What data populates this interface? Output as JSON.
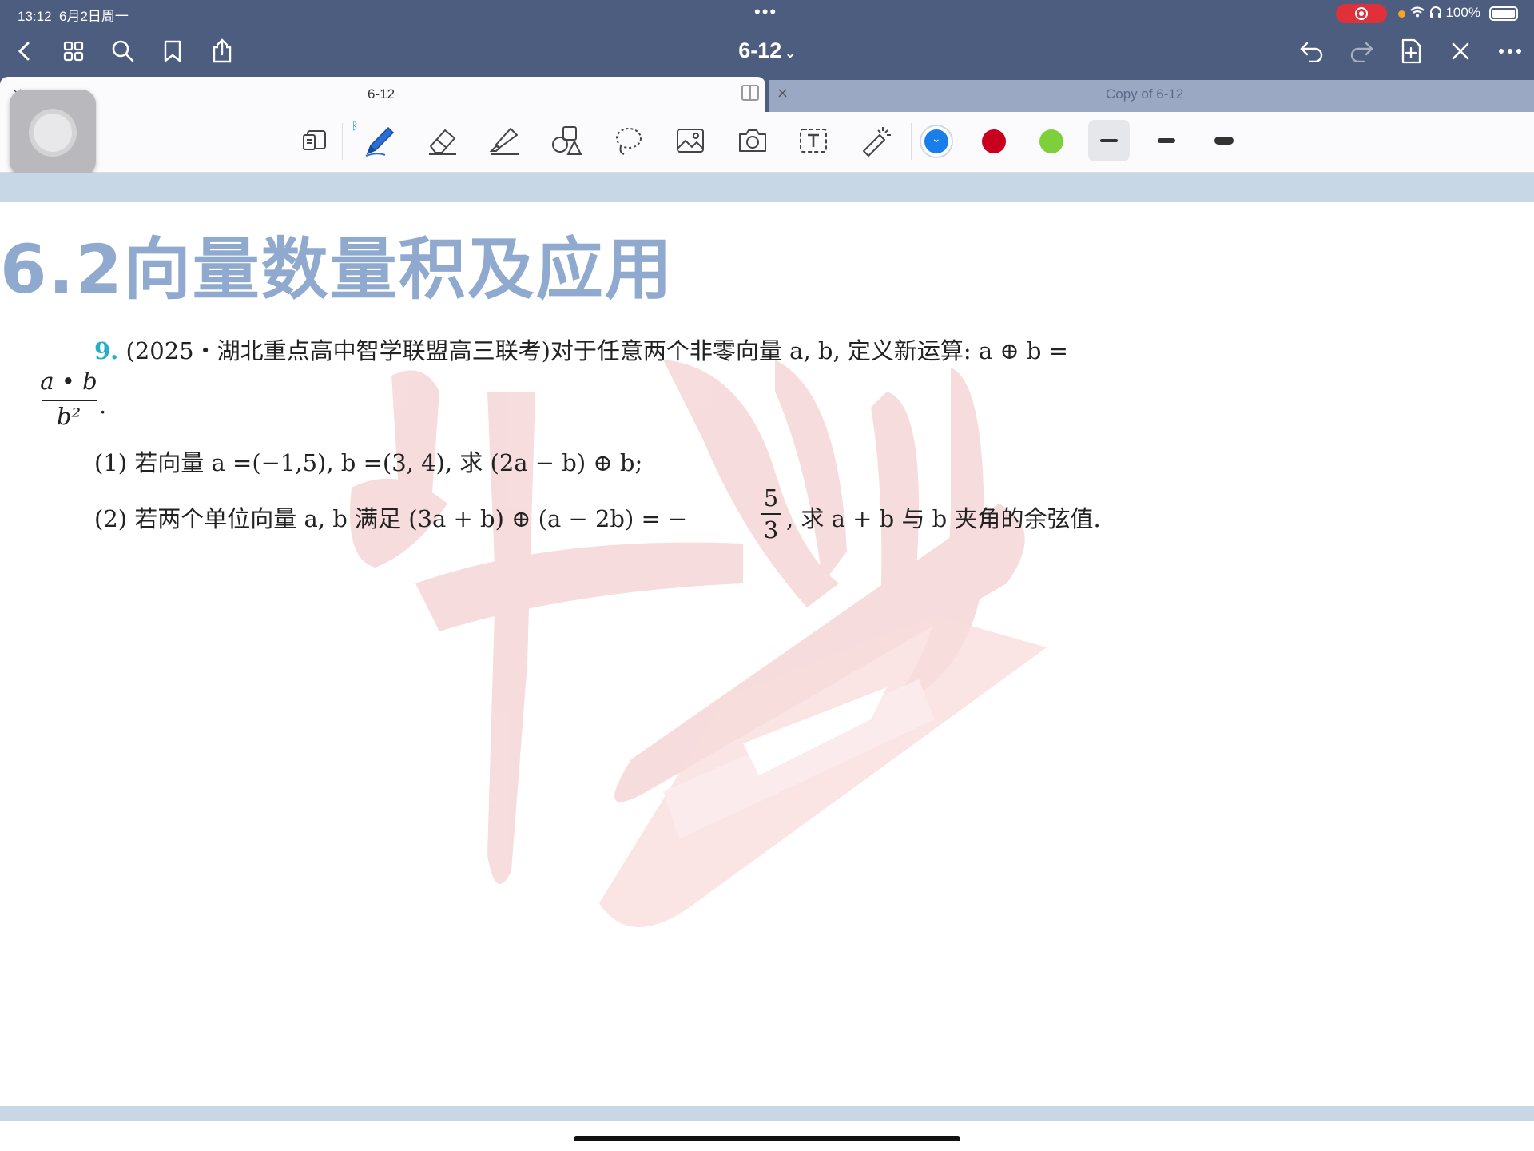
{
  "status_bar": {
    "time": "13:12",
    "date": "6月2日周一",
    "center_dots": "•••",
    "battery_text": "100%"
  },
  "nav": {
    "title": "6-12",
    "icons": [
      "back-icon",
      "grid-icon",
      "search-icon",
      "bookmark-icon",
      "share-icon",
      "undo-icon",
      "redo-icon",
      "add-page-icon",
      "close-x-icon",
      "more-icon"
    ]
  },
  "tabs": [
    {
      "label": "6-12",
      "active": true
    },
    {
      "label": "Copy of 6-12",
      "active": false
    }
  ],
  "toolbar": {
    "tools": [
      "read-mode-icon",
      "pen-icon",
      "eraser-icon",
      "highlighter-icon",
      "shapes-icon",
      "lasso-icon",
      "image-icon",
      "camera-icon",
      "text-box-icon",
      "laser-pointer-icon"
    ],
    "colors": [
      "#1a7ee8",
      "#c8001e",
      "#7ed03a"
    ],
    "stroke_widths": [
      "thin",
      "medium",
      "thick"
    ]
  },
  "document": {
    "heading": "6.2向量数量积及应用",
    "question": {
      "number": "9.",
      "line1": "(2025・湖北重点高中智学联盟高三联考)对于任意两个非零向量 a, b, 定义新运算: a ⊕ b =",
      "frac_num": "a • b",
      "frac_den": "b²",
      "frac_tail": ".",
      "part1": "(1) 若向量 a =(−1,5), b =(3, 4), 求 (2a − b) ⊕ b;",
      "part2_pre": "(2) 若两个单位向量 a, b 满足 (3a + b) ⊕ (a − 2b) = −",
      "part2_num": "5",
      "part2_den": "3",
      "part2_post": ", 求 a + b 与 b 夹角的余弦值."
    }
  }
}
